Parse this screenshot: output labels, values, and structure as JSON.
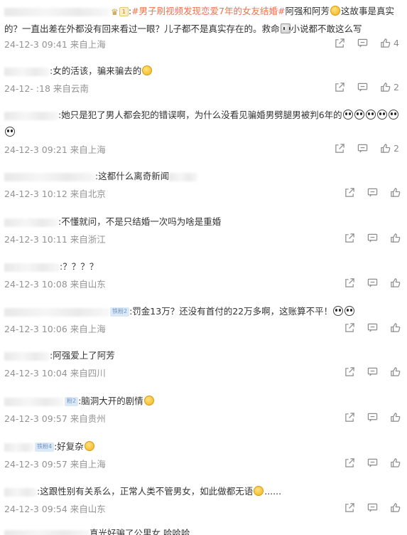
{
  "comments": [
    {
      "text_prefix": "#男子刷视频发现恋爱7年的女友结婚#",
      "text": "阿强和阿芳",
      "text_cont": "这故事是真实的？一直出差在外都没有回来看过一眼？儿子都不是真实存在的。救命",
      "text_end": "小说都不敢这么写",
      "meta": "24-12-3 09:41 来自上海",
      "likes": "4",
      "badge": "1"
    },
    {
      "text": ":女的活该，骗来骗去的",
      "meta": "24-12-  :18 来自云南",
      "likes": "2"
    },
    {
      "text": ":她只是犯了男人都会犯的错误啊，为什么没看见骗婚男劈腿男被判6年的",
      "meta": "24-12-3 09:21 来自上海",
      "likes": "2"
    },
    {
      "text": ":这都什么离奇新闻",
      "meta": "24-12-3 10:12 来自北京"
    },
    {
      "text": ":不懂就问，不是只结婚一次吗为啥是重婚",
      "meta": "24-12-3 10:11 来自浙江"
    },
    {
      "text": ":？？？？",
      "meta": "24-12-3 10:08 来自山东"
    },
    {
      "text": ":罚金13万？还没有首付的22万多啊，这账算不平！",
      "meta": "24-12-3 10:06 来自上海",
      "badge": "铁粉2"
    },
    {
      "text": ":阿强爱上了阿芳",
      "meta": "24-12-3 10:04 来自四川"
    },
    {
      "text": ":脑洞大开的剧情",
      "meta": "24-12-3 09:57 来自贵州",
      "badge": "粉2"
    },
    {
      "text": ":好复杂",
      "meta": "24-12-3 09:57 来自上海",
      "badge": "铁粉4"
    },
    {
      "text": ":这跟性别有关系么，正常人类不管男女，如此做都无语",
      "text_end": "......",
      "meta": "24-12-3 09:54 来自山东"
    },
    {
      "text": "真光好骗了公里女 哈哈哈"
    }
  ],
  "icons": {
    "share": "share-icon",
    "comment": "comment-icon",
    "like": "like-icon"
  },
  "colors": {
    "topic": "#eb7350",
    "meta": "#939393",
    "text": "#333333",
    "badge": "#6f95c4"
  }
}
